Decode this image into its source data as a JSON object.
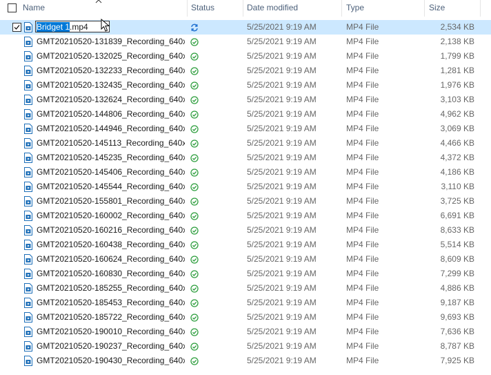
{
  "columns": {
    "name": "Name",
    "status": "Status",
    "date_modified": "Date modified",
    "type": "Type",
    "size": "Size"
  },
  "rename": {
    "selected_text": "Bridget 1",
    "rest_text": ".mp4"
  },
  "colors": {
    "selection_bg": "#cce8ff",
    "header_text": "#4c607a",
    "status_ok": "#2e9e3e",
    "status_sync": "#1e6fd0",
    "rename_highlight": "#0078d7"
  },
  "rows": [
    {
      "name": "Bridget 1.mp4",
      "status_icon": "sync-icon",
      "date": "5/25/2021 9:19 AM",
      "type": "MP4 File",
      "size": "2,534 KB",
      "selected": true
    },
    {
      "name": "GMT20210520-131839_Recording_640x…",
      "status_icon": "synced-check-icon",
      "date": "5/25/2021 9:19 AM",
      "type": "MP4 File",
      "size": "2,138 KB"
    },
    {
      "name": "GMT20210520-132025_Recording_640x…",
      "status_icon": "synced-check-icon",
      "date": "5/25/2021 9:19 AM",
      "type": "MP4 File",
      "size": "1,799 KB"
    },
    {
      "name": "GMT20210520-132233_Recording_640x…",
      "status_icon": "synced-check-icon",
      "date": "5/25/2021 9:19 AM",
      "type": "MP4 File",
      "size": "1,281 KB"
    },
    {
      "name": "GMT20210520-132435_Recording_640x…",
      "status_icon": "synced-check-icon",
      "date": "5/25/2021 9:19 AM",
      "type": "MP4 File",
      "size": "1,976 KB"
    },
    {
      "name": "GMT20210520-132624_Recording_640x…",
      "status_icon": "synced-check-icon",
      "date": "5/25/2021 9:19 AM",
      "type": "MP4 File",
      "size": "3,103 KB"
    },
    {
      "name": "GMT20210520-144806_Recording_640x…",
      "status_icon": "synced-check-icon",
      "date": "5/25/2021 9:19 AM",
      "type": "MP4 File",
      "size": "4,962 KB"
    },
    {
      "name": "GMT20210520-144946_Recording_640x…",
      "status_icon": "synced-check-icon",
      "date": "5/25/2021 9:19 AM",
      "type": "MP4 File",
      "size": "3,069 KB"
    },
    {
      "name": "GMT20210520-145113_Recording_640x…",
      "status_icon": "synced-check-icon",
      "date": "5/25/2021 9:19 AM",
      "type": "MP4 File",
      "size": "4,466 KB"
    },
    {
      "name": "GMT20210520-145235_Recording_640x…",
      "status_icon": "synced-check-icon",
      "date": "5/25/2021 9:19 AM",
      "type": "MP4 File",
      "size": "4,372 KB"
    },
    {
      "name": "GMT20210520-145406_Recording_640x…",
      "status_icon": "synced-check-icon",
      "date": "5/25/2021 9:19 AM",
      "type": "MP4 File",
      "size": "4,186 KB"
    },
    {
      "name": "GMT20210520-145544_Recording_640x…",
      "status_icon": "synced-check-icon",
      "date": "5/25/2021 9:19 AM",
      "type": "MP4 File",
      "size": "3,110 KB"
    },
    {
      "name": "GMT20210520-155801_Recording_640x…",
      "status_icon": "synced-check-icon",
      "date": "5/25/2021 9:19 AM",
      "type": "MP4 File",
      "size": "3,725 KB"
    },
    {
      "name": "GMT20210520-160002_Recording_640x…",
      "status_icon": "synced-check-icon",
      "date": "5/25/2021 9:19 AM",
      "type": "MP4 File",
      "size": "6,691 KB"
    },
    {
      "name": "GMT20210520-160216_Recording_640x…",
      "status_icon": "synced-check-icon",
      "date": "5/25/2021 9:19 AM",
      "type": "MP4 File",
      "size": "8,633 KB"
    },
    {
      "name": "GMT20210520-160438_Recording_640x…",
      "status_icon": "synced-check-icon",
      "date": "5/25/2021 9:19 AM",
      "type": "MP4 File",
      "size": "5,514 KB"
    },
    {
      "name": "GMT20210520-160624_Recording_640x…",
      "status_icon": "synced-check-icon",
      "date": "5/25/2021 9:19 AM",
      "type": "MP4 File",
      "size": "8,609 KB"
    },
    {
      "name": "GMT20210520-160830_Recording_640x…",
      "status_icon": "synced-check-icon",
      "date": "5/25/2021 9:19 AM",
      "type": "MP4 File",
      "size": "7,299 KB"
    },
    {
      "name": "GMT20210520-185255_Recording_640x…",
      "status_icon": "synced-check-icon",
      "date": "5/25/2021 9:19 AM",
      "type": "MP4 File",
      "size": "4,886 KB"
    },
    {
      "name": "GMT20210520-185453_Recording_640x…",
      "status_icon": "synced-check-icon",
      "date": "5/25/2021 9:19 AM",
      "type": "MP4 File",
      "size": "9,187 KB"
    },
    {
      "name": "GMT20210520-185722_Recording_640x…",
      "status_icon": "synced-check-icon",
      "date": "5/25/2021 9:19 AM",
      "type": "MP4 File",
      "size": "9,693 KB"
    },
    {
      "name": "GMT20210520-190010_Recording_640x…",
      "status_icon": "synced-check-icon",
      "date": "5/25/2021 9:19 AM",
      "type": "MP4 File",
      "size": "7,636 KB"
    },
    {
      "name": "GMT20210520-190237_Recording_640x…",
      "status_icon": "synced-check-icon",
      "date": "5/25/2021 9:19 AM",
      "type": "MP4 File",
      "size": "8,787 KB"
    },
    {
      "name": "GMT20210520-190430_Recording_640x…",
      "status_icon": "synced-check-icon",
      "date": "5/25/2021 9:19 AM",
      "type": "MP4 File",
      "size": "7,925 KB"
    }
  ]
}
